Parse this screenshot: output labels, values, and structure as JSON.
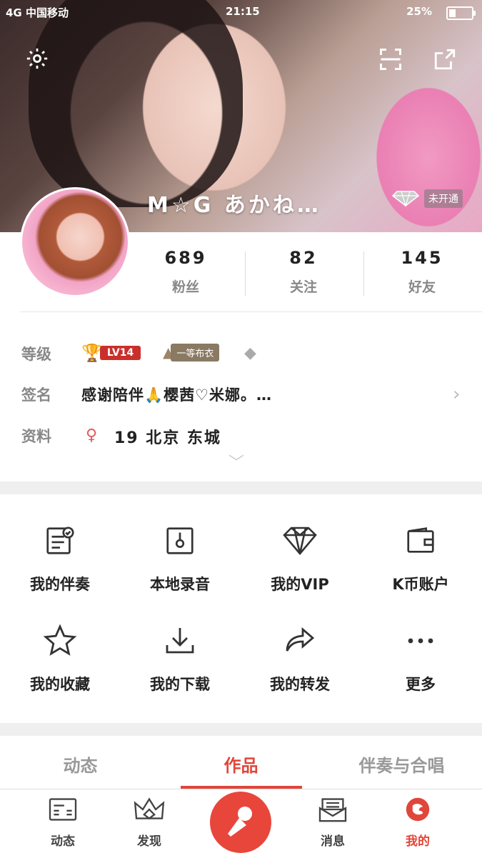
{
  "status_bar": {
    "carrier": "4G 中国移动",
    "time": "21:15",
    "battery": "25%",
    "battery_level": 0.25
  },
  "header": {
    "username": "M☆G あかね…",
    "vip_status": "未开通"
  },
  "stats": [
    {
      "value": "689",
      "label": "粉丝"
    },
    {
      "value": "82",
      "label": "关注"
    },
    {
      "value": "145",
      "label": "好友"
    }
  ],
  "info": {
    "level_label": "等级",
    "level_badge": "LV14",
    "rank_badge": "一等布衣",
    "signature_label": "签名",
    "signature": "感谢陪伴🙏樱茜♡米娜。…",
    "profile_label": "资料",
    "profile_text": "19 北京 东城"
  },
  "grid": [
    {
      "label": "我的伴奏",
      "icon": "accompaniment-icon"
    },
    {
      "label": "本地录音",
      "icon": "local-recording-icon"
    },
    {
      "label": "我的VIP",
      "icon": "vip-diamond-icon"
    },
    {
      "label": "K币账户",
      "icon": "wallet-icon"
    },
    {
      "label": "我的收藏",
      "icon": "star-icon"
    },
    {
      "label": "我的下载",
      "icon": "download-icon"
    },
    {
      "label": "我的转发",
      "icon": "share-forward-icon"
    },
    {
      "label": "更多",
      "icon": "more-icon"
    }
  ],
  "tabs": [
    "动态",
    "作品",
    "伴奏与合唱"
  ],
  "active_tab": "作品",
  "bottom_nav": [
    {
      "label": "动态",
      "icon": "feed-icon"
    },
    {
      "label": "发现",
      "icon": "crown-icon"
    },
    {
      "label": "",
      "icon": "microphone-icon"
    },
    {
      "label": "消息",
      "icon": "message-icon"
    },
    {
      "label": "我的",
      "icon": "profile-icon"
    }
  ],
  "colors": {
    "accent": "#e0463a",
    "level_badge": "#c9302c",
    "divider_band": "#efefef"
  }
}
